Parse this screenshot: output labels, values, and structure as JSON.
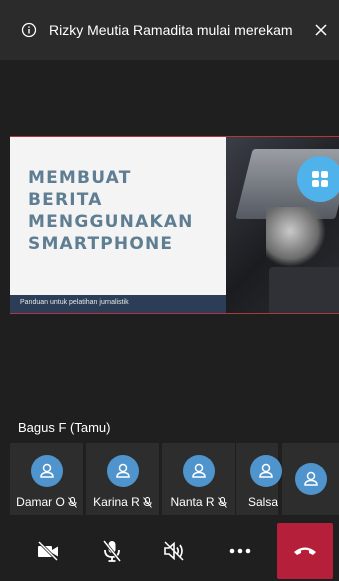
{
  "notification": {
    "text": "Rizky Meutia Ramadita mulai merekam",
    "info_icon": "info-icon",
    "close_icon": "close-icon"
  },
  "shared_slide": {
    "title": "MEMBUAT\nBERITA\nMENGGUNAKAN\nSMARTPHONE",
    "subtitle": "Panduan untuk pelatihan jurnalistik"
  },
  "active_speaker": {
    "name": "Bagus F (Tamu)"
  },
  "participants": [
    {
      "name": "Damar O",
      "muted": true
    },
    {
      "name": "Karina R",
      "muted": true
    },
    {
      "name": "Nanta R",
      "muted": true
    },
    {
      "name": "Salsa",
      "muted": false
    },
    {
      "name": "",
      "muted": false
    }
  ],
  "toolbar": {
    "buttons": [
      "camera-off-icon",
      "mic-off-icon",
      "speaker-off-icon",
      "more-icon",
      "hang-up-icon"
    ]
  },
  "colors": {
    "background": "#1f1f1f",
    "banner": "#2b2b2b",
    "avatar": "#4f94cc",
    "grid_button": "#4fb2ea",
    "hang_up": "#b61f3a",
    "slide_title": "#5f7e93"
  }
}
